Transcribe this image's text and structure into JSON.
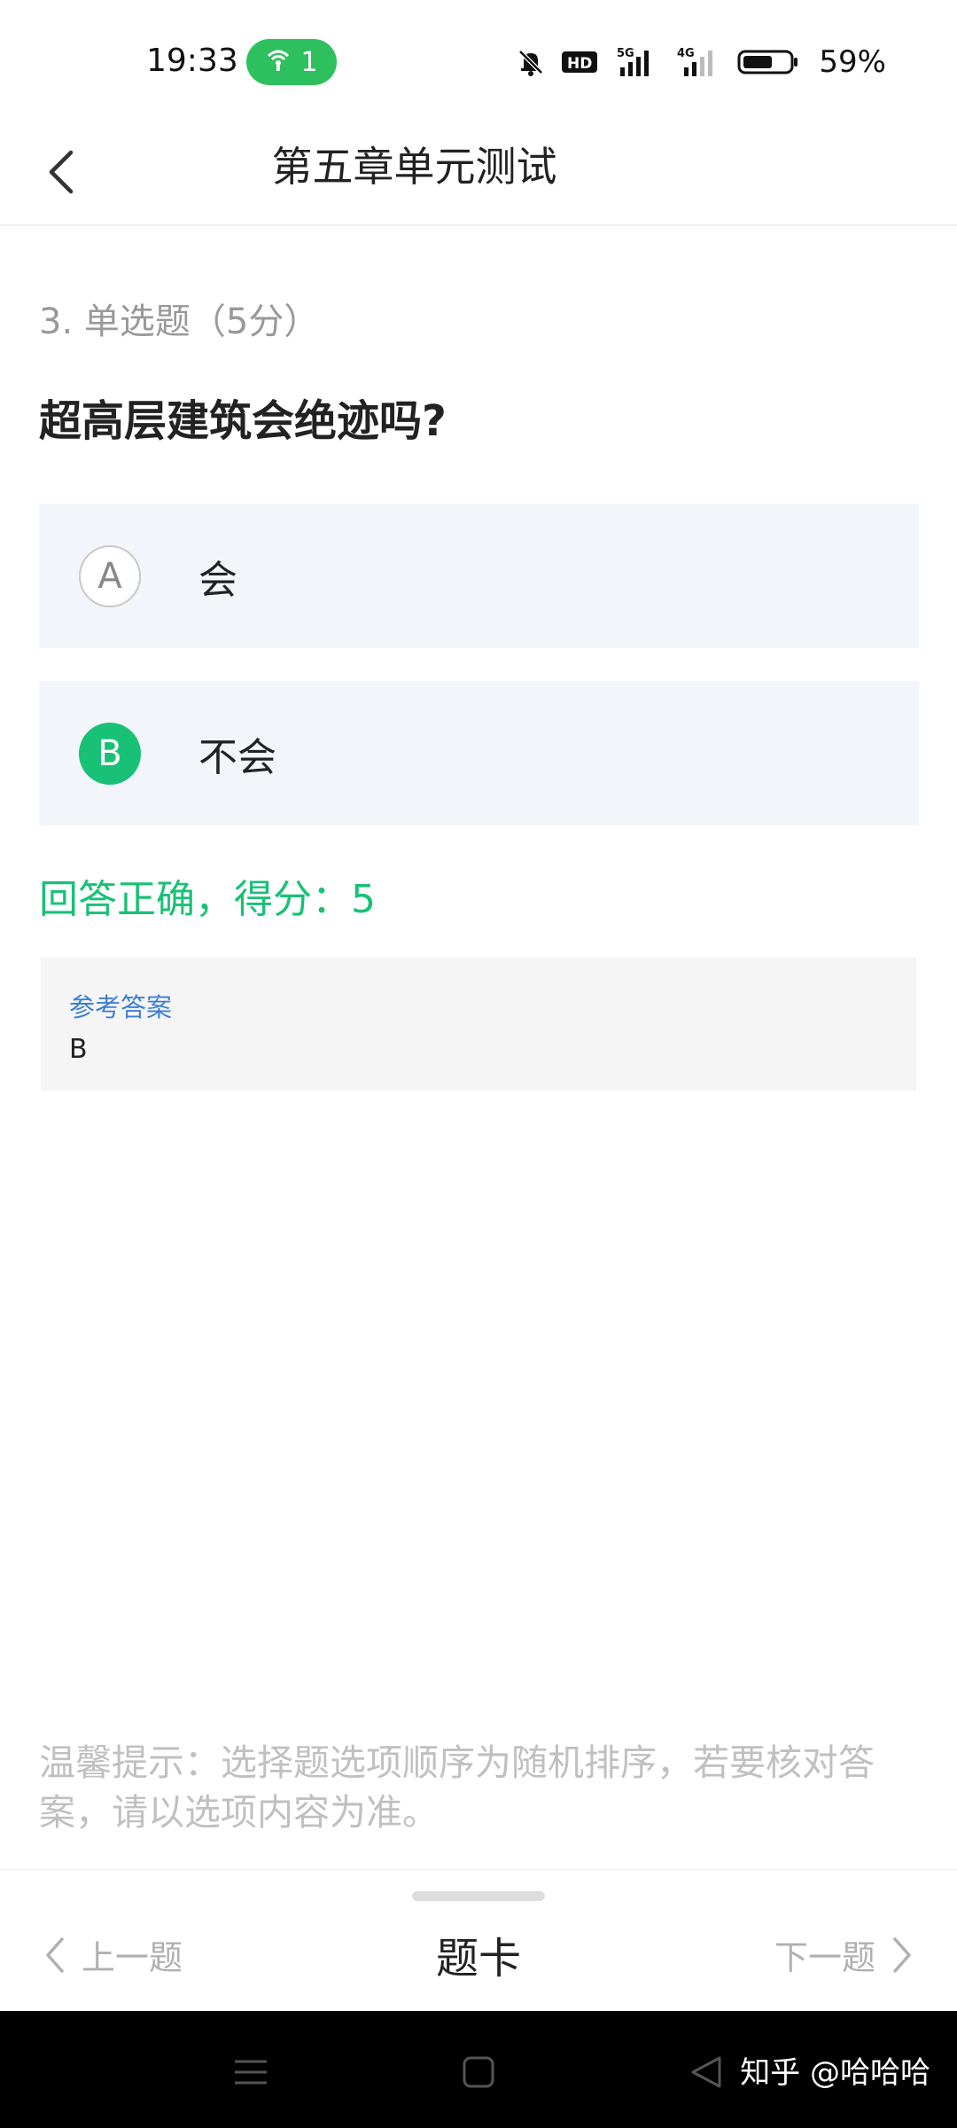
{
  "status_bar": {
    "time": "19:33",
    "hotspot_count": "1",
    "network_labels": [
      "HD",
      "5G",
      "4G"
    ],
    "battery_percent": "59%",
    "colors": {
      "hotspot": "#2ec05e"
    }
  },
  "header": {
    "title": "第五章单元测试",
    "back_icon": "chevron-left-icon"
  },
  "question": {
    "meta": "3. 单选题（5分）",
    "stem": "超高层建筑会绝迹吗?",
    "options": [
      {
        "letter": "A",
        "text": "会",
        "selected": false
      },
      {
        "letter": "B",
        "text": "不会",
        "selected": true
      }
    ],
    "result": "回答正确，得分：5",
    "reference": {
      "label": "参考答案",
      "value": "B"
    },
    "tip": "温馨提示：选择题选项顺序为随机排序，若要核对答案，请以选项内容为准。"
  },
  "bottom_bar": {
    "prev_label": "上一题",
    "card_label": "题卡",
    "next_label": "下一题"
  },
  "system_nav": {
    "watermark": "知乎 @哈哈哈"
  },
  "colors": {
    "accent_green": "#18c175",
    "reference_label": "#3d7fd6",
    "option_bg": "#f2f6fa"
  }
}
